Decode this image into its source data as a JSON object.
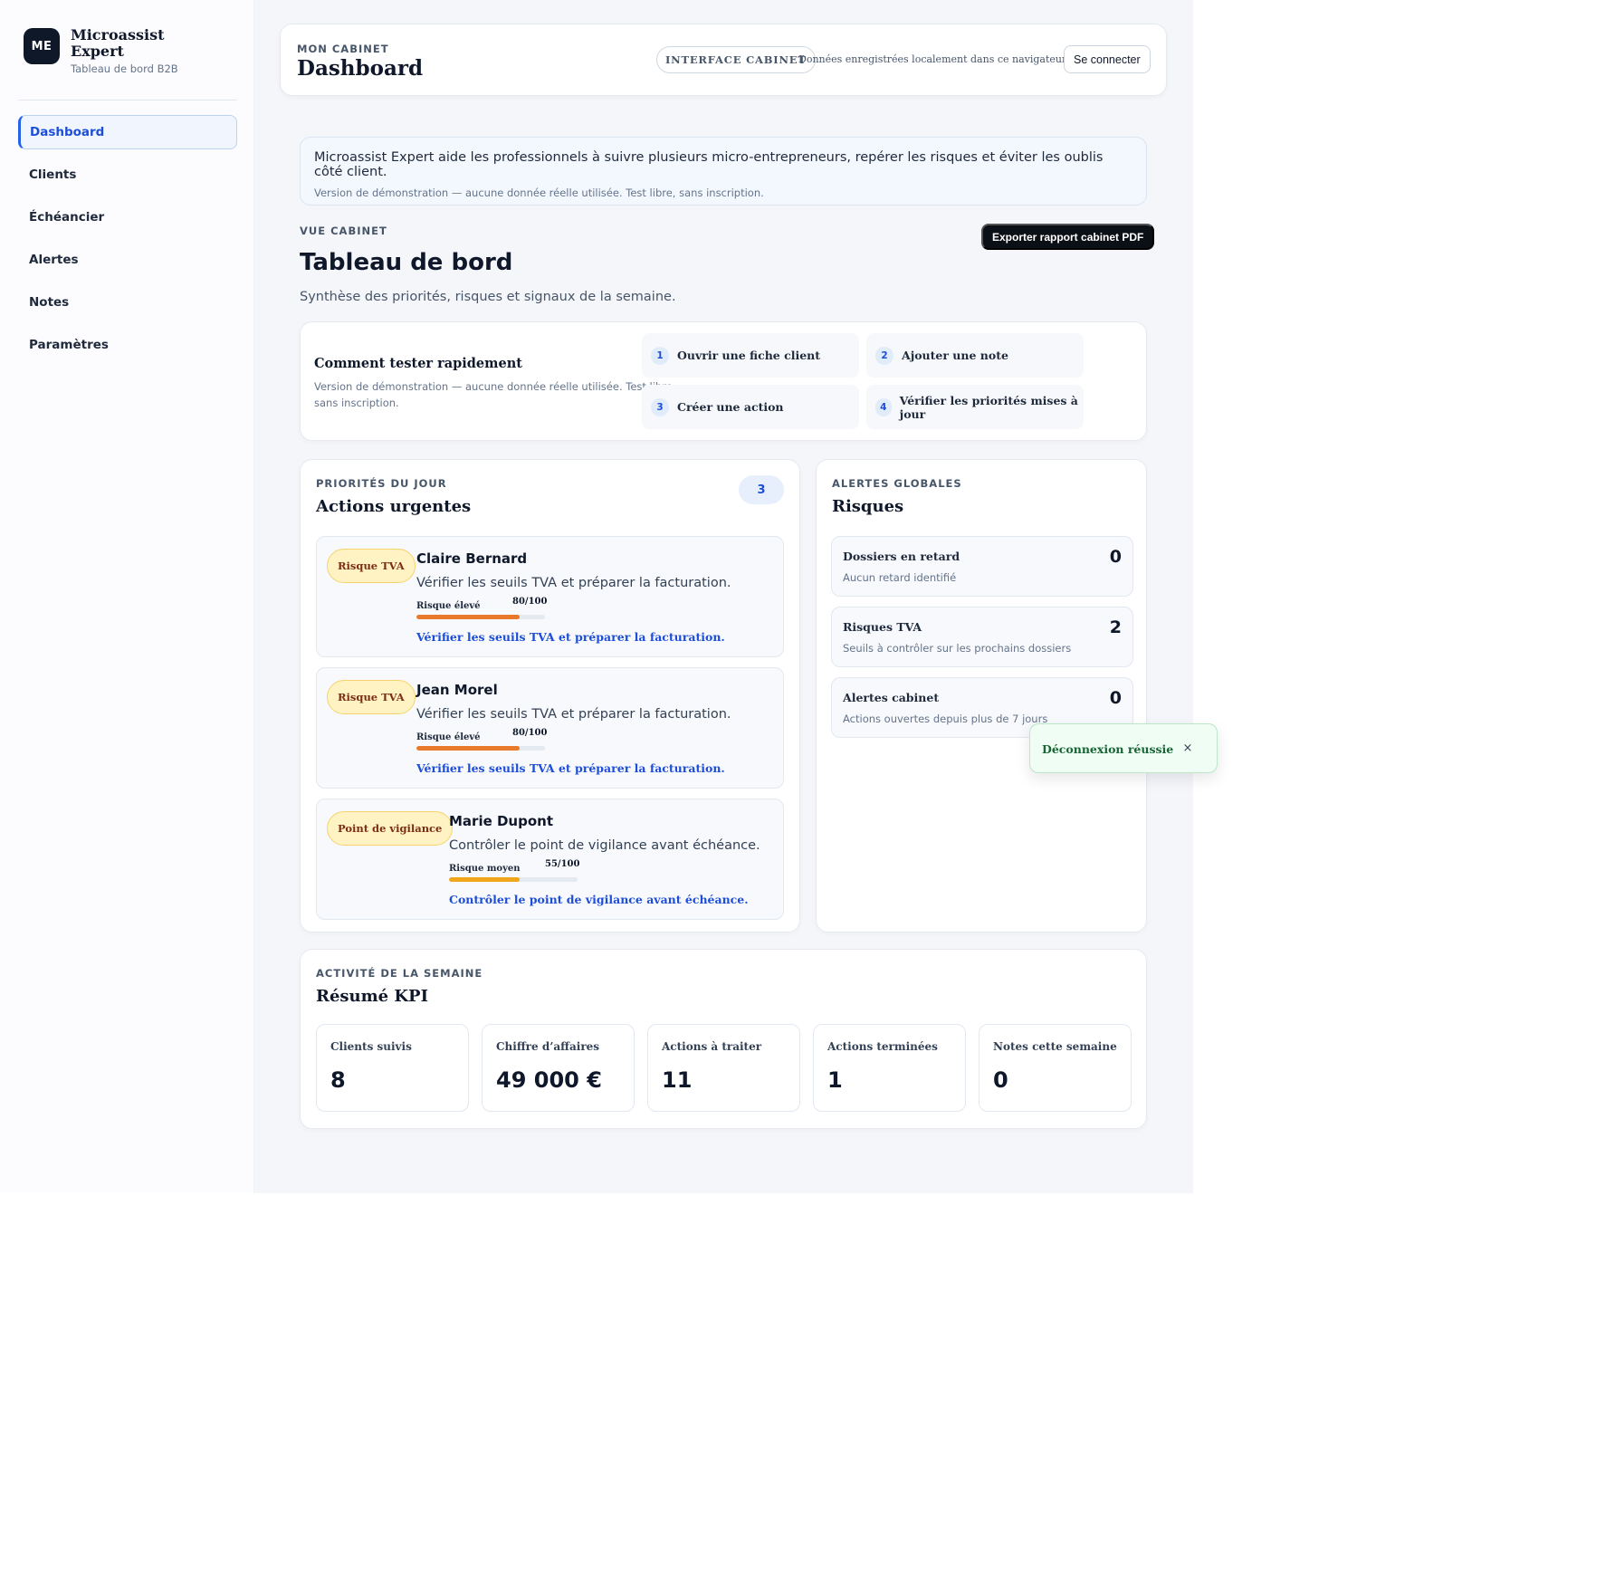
{
  "sidebar": {
    "logo_text": "ME",
    "brand_name": "Microassist Expert",
    "brand_sub": "Tableau de bord B2B",
    "items": [
      {
        "label": "Dashboard",
        "active": true
      },
      {
        "label": "Clients"
      },
      {
        "label": "Échéancier"
      },
      {
        "label": "Alertes"
      },
      {
        "label": "Notes"
      },
      {
        "label": "Paramètres"
      }
    ]
  },
  "topbar": {
    "eyebrow": "MON CABINET",
    "title": "Dashboard",
    "pill": "INTERFACE CABINET",
    "local_note": "Données enregistrées localement dans ce navigateur.",
    "login": "Se connecter"
  },
  "info": {
    "line1": "Microassist Expert aide les professionnels à suivre plusieurs micro-entrepreneurs, repérer les risques et éviter les oublis côté client.",
    "line2": "Version de démonstration — aucune donnée réelle utilisée. Test libre, sans inscription."
  },
  "vue": {
    "eyebrow": "VUE CABINET",
    "export": "Exporter rapport cabinet PDF",
    "title": "Tableau de bord",
    "subtitle": "Synthèse des priorités, risques et signaux de la semaine."
  },
  "howto": {
    "title": "Comment tester rapidement",
    "text": "Version de démonstration — aucune donnée réelle utilisée. Test libre, sans inscription.",
    "steps": [
      {
        "num": "1",
        "label": "Ouvrir une fiche client"
      },
      {
        "num": "2",
        "label": "Ajouter une note"
      },
      {
        "num": "3",
        "label": "Créer une action"
      },
      {
        "num": "4",
        "label": "Vérifier les priorités mises à jour"
      }
    ]
  },
  "priorities": {
    "eyebrow": "PRIORITÉS DU JOUR",
    "title": "Actions urgentes",
    "count": "3",
    "items": [
      {
        "badge": "Risque TVA",
        "name": "Claire Bernard",
        "desc": "Vérifier les seuils TVA et préparer la facturation.",
        "level": "Risque élevé",
        "score_text": "80/100",
        "score": 80,
        "color": "#ea7a2b",
        "link": "Vérifier les seuils TVA et préparer la facturation."
      },
      {
        "badge": "Risque TVA",
        "name": "Jean Morel",
        "desc": "Vérifier les seuils TVA et préparer la facturation.",
        "level": "Risque élevé",
        "score_text": "80/100",
        "score": 80,
        "color": "#ea7a2b",
        "link": "Vérifier les seuils TVA et préparer la facturation."
      },
      {
        "badge": "Point de vigilance",
        "name": "Marie Dupont",
        "desc": "Contrôler le point de vigilance avant échéance.",
        "level": "Risque moyen",
        "score_text": "55/100",
        "score": 55,
        "color": "#f0a51a",
        "link": "Contrôler le point de vigilance avant échéance."
      }
    ]
  },
  "risks": {
    "eyebrow": "ALERTES GLOBALES",
    "title": "Risques",
    "items": [
      {
        "title": "Dossiers en retard",
        "sub": "Aucun retard identifié",
        "value": "0"
      },
      {
        "title": "Risques TVA",
        "sub": "Seuils à contrôler sur les prochains dossiers",
        "value": "2"
      },
      {
        "title": "Alertes cabinet",
        "sub": "Actions ouvertes depuis plus de 7 jours",
        "value": "0"
      }
    ]
  },
  "kpi": {
    "eyebrow": "ACTIVITÉ DE LA SEMAINE",
    "title": "Résumé KPI",
    "items": [
      {
        "title": "Clients suivis",
        "value": "8"
      },
      {
        "title": "Chiffre d’affaires",
        "value": "49 000 €"
      },
      {
        "title": "Actions à traiter",
        "value": "11"
      },
      {
        "title": "Actions terminées",
        "value": "1"
      },
      {
        "title": "Notes cette semaine",
        "value": "0"
      }
    ]
  },
  "toast": {
    "message": "Déconnexion réussie",
    "close": "×"
  }
}
